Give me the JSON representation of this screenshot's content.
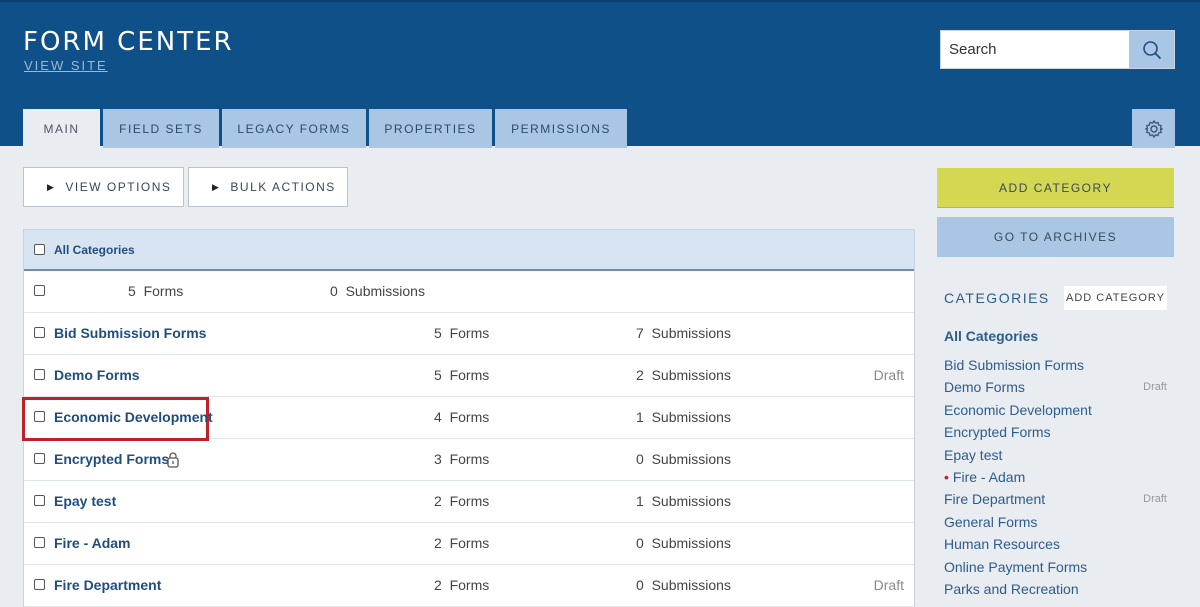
{
  "header": {
    "title": "FORM CENTER",
    "view_site": "VIEW SITE",
    "search_placeholder": "Search"
  },
  "tabs": [
    {
      "label": "MAIN",
      "active": true
    },
    {
      "label": "FIELD SETS"
    },
    {
      "label": "LEGACY FORMS"
    },
    {
      "label": "PROPERTIES"
    },
    {
      "label": "PERMISSIONS"
    }
  ],
  "toolbar": {
    "view_options": "VIEW OPTIONS",
    "bulk_actions": "BULK ACTIONS"
  },
  "table": {
    "header_label": "All Categories",
    "summary": {
      "forms": "5",
      "forms_label": "Forms",
      "subs": "0",
      "subs_label": "Submissions"
    },
    "rows": [
      {
        "name": "Bid Submission Forms",
        "forms": "5",
        "forms_label": "Forms",
        "subs": "7",
        "subs_label": "Submissions",
        "status": ""
      },
      {
        "name": "Demo Forms",
        "forms": "5",
        "forms_label": "Forms",
        "subs": "2",
        "subs_label": "Submissions",
        "status": "Draft"
      },
      {
        "name": "Economic Development",
        "forms": "4",
        "forms_label": "Forms",
        "subs": "1",
        "subs_label": "Submissions",
        "status": ""
      },
      {
        "name": "Encrypted Forms",
        "forms": "3",
        "forms_label": "Forms",
        "subs": "0",
        "subs_label": "Submissions",
        "status": ""
      },
      {
        "name": "Epay test",
        "forms": "2",
        "forms_label": "Forms",
        "subs": "1",
        "subs_label": "Submissions",
        "status": ""
      },
      {
        "name": "Fire - Adam",
        "forms": "2",
        "forms_label": "Forms",
        "subs": "0",
        "subs_label": "Submissions",
        "status": ""
      },
      {
        "name": "Fire Department",
        "forms": "2",
        "forms_label": "Forms",
        "subs": "0",
        "subs_label": "Submissions",
        "status": "Draft"
      }
    ]
  },
  "sidebar": {
    "add_category": "ADD CATEGORY",
    "go_to_archives": "GO TO ARCHIVES",
    "categories_title": "CATEGORIES",
    "categories_add": "ADD CATEGORY",
    "items": [
      {
        "label": "All Categories",
        "status": ""
      },
      {
        "label": "Bid Submission Forms",
        "status": ""
      },
      {
        "label": "Demo Forms",
        "status": "Draft"
      },
      {
        "label": "Economic Development",
        "status": ""
      },
      {
        "label": "Encrypted Forms",
        "status": ""
      },
      {
        "label": "Epay test",
        "status": ""
      },
      {
        "label": "Fire - Adam",
        "status": ""
      },
      {
        "label": "Fire Department",
        "status": "Draft"
      },
      {
        "label": "General Forms",
        "status": ""
      },
      {
        "label": "Human Resources",
        "status": ""
      },
      {
        "label": "Online Payment Forms",
        "status": ""
      },
      {
        "label": "Parks and Recreation",
        "status": ""
      }
    ]
  },
  "colors": {
    "header_bg": "#0f5089",
    "tab_bg": "#a9c6e5",
    "add_category_bg": "#d3d751",
    "archives_bg": "#a9c6e5",
    "highlight": "#c0202a"
  }
}
